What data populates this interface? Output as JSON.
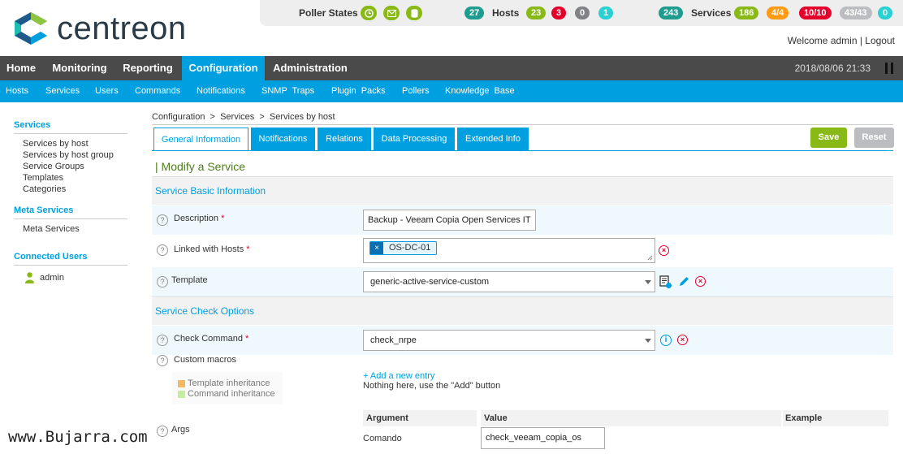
{
  "header": {
    "logo_text": "centreon",
    "welcome_text": "Welcome admin | Logout",
    "poller_states_label": "Poller States",
    "hosts_label": "Hosts",
    "services_label": "Services",
    "hosts_counts": [
      "27",
      "23",
      "3",
      "0",
      "1"
    ],
    "services_counts": [
      "243",
      "186",
      "4/4",
      "10/10",
      "43/43",
      "0"
    ],
    "colors": {
      "ok": "#88b917",
      "critical": "#e4002b",
      "warning": "#ff9a13",
      "unknown": "#bcbdc0",
      "pending": "#1ebeb3",
      "total": "#1d9c8f"
    }
  },
  "main_nav": {
    "items": [
      "Home",
      "Monitoring",
      "Reporting",
      "Configuration",
      "Administration"
    ],
    "active": "Configuration",
    "datetime": "2018/08/06 21:33"
  },
  "sub_nav": {
    "items": [
      "Hosts",
      "Services",
      "Users",
      "Commands",
      "Notifications",
      "SNMP  Traps",
      "Plugin  Packs",
      "Pollers",
      "Knowledge  Base"
    ]
  },
  "sidebar": {
    "services_title": "Services",
    "services_items": [
      "Services by host",
      "Services by host group",
      "Service Groups",
      "Templates",
      "Categories"
    ],
    "meta_title": "Meta Services",
    "meta_items": [
      "Meta Services"
    ],
    "connected_title": "Connected Users",
    "connected_users": [
      "admin"
    ]
  },
  "breadcrumb": "Configuration  >  Services  >  Services by host",
  "tabs": [
    "General Information",
    "Notifications",
    "Relations",
    "Data Processing",
    "Extended Info"
  ],
  "buttons": {
    "save": "Save",
    "reset": "Reset"
  },
  "form": {
    "title": "| Modify a Service",
    "section_basic": "Service Basic Information",
    "description_label": "Description",
    "description_value": "Backup - Veeam Copia Open Services IT",
    "linked_hosts_label": "Linked with Hosts",
    "linked_host_chip": "OS-DC-01",
    "template_label": "Template",
    "template_value": "generic-active-service-custom",
    "section_check": "Service Check Options",
    "check_command_label": "Check Command",
    "check_command_value": "check_nrpe",
    "custom_macros_label": "Custom macros",
    "legend_template": "Template inheritance",
    "legend_command": "Command inheritance",
    "add_entry": "+ Add a new entry",
    "nothing_here": "Nothing here, use the \"Add\" button",
    "args_label": "Args",
    "args_headers": [
      "Argument",
      "Value",
      "Example"
    ],
    "args_rows": [
      {
        "argument": "Comando",
        "value": "check_veeam_copia_os"
      }
    ],
    "required_mark": "*",
    "help_mark": "?"
  },
  "watermark": "www.Bujarra.com"
}
